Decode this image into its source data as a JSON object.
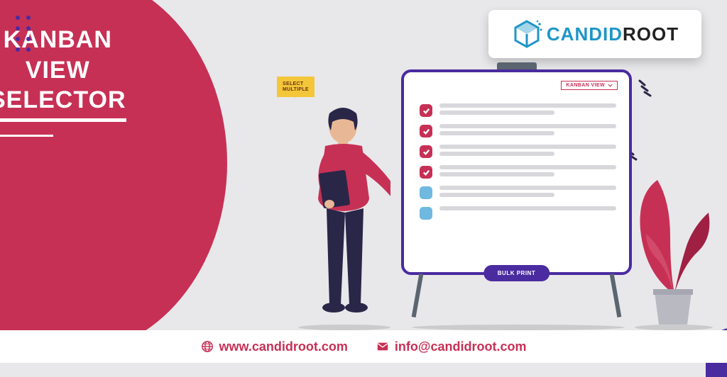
{
  "title": {
    "line1": "KANBAN",
    "line2": "VIEW",
    "line3": "SELECTOR"
  },
  "brand": {
    "accent": "CANDID",
    "rest": "ROOT"
  },
  "bubble": {
    "line1": "SELECT",
    "line2": "MULTIPLE"
  },
  "dropdown_label": "KANBAN VIEW",
  "rows": [
    {
      "selected": true,
      "lines": 2
    },
    {
      "selected": true,
      "lines": 2
    },
    {
      "selected": true,
      "lines": 2
    },
    {
      "selected": true,
      "lines": 2
    },
    {
      "selected": false,
      "lines": 2
    },
    {
      "selected": false,
      "lines": 1
    }
  ],
  "bulk_label": "BULK PRINT",
  "footer": {
    "web": "www.candidroot.com",
    "mail": "info@candidroot.com"
  }
}
